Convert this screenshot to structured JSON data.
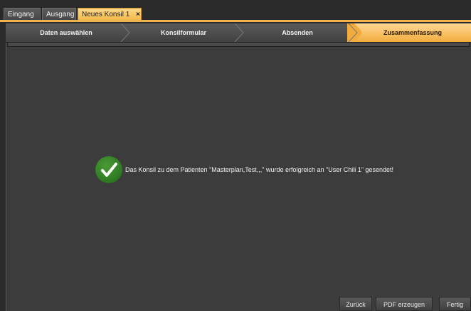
{
  "tabs": [
    {
      "label": "Eingang"
    },
    {
      "label": "Ausgang"
    },
    {
      "label": "Neues Konsil 1",
      "close": "×",
      "active": true
    }
  ],
  "wizard": {
    "steps": [
      {
        "label": "Daten auswählen"
      },
      {
        "label": "Konsilformular"
      },
      {
        "label": "Absenden"
      },
      {
        "label": "Zusammenfassung",
        "active": true
      }
    ]
  },
  "summary": {
    "icon": "checkmark-icon",
    "message": "Das Konsil zu dem Patienten \"Masterplan,Test,,,\" wurde erfolgreich an \"User Chili 1\" gesendet!"
  },
  "footer": {
    "back_label": "Zurück",
    "pdf_label": "PDF erzeugen",
    "done_label": "Fertig"
  },
  "colors": {
    "accent": "#f2ac3e",
    "background": "#3c3c3c",
    "success": "#2f7d25"
  }
}
